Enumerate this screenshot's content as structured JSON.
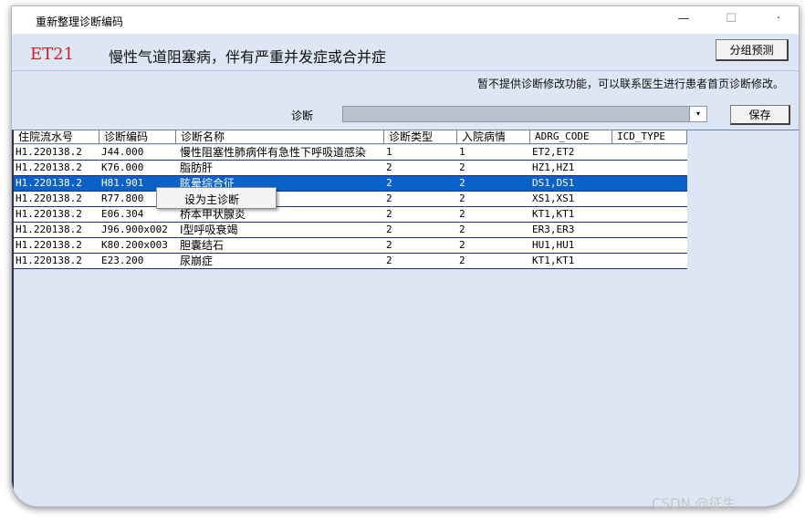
{
  "window": {
    "title": "重新整理诊断编码",
    "minimize": "—",
    "maximize": "☐",
    "close": "·"
  },
  "group": {
    "code": "ET21",
    "name": "慢性气道阻塞病，伴有严重并发症或合并症",
    "predict_label": "分组预测"
  },
  "notice": "暂不提供诊断修改功能，可以联系医生进行患者首页诊断修改。",
  "diagnosis": {
    "label": "诊断",
    "value": "",
    "arrow": "▾",
    "save_label": "保存"
  },
  "table": {
    "columns": [
      "住院流水号",
      "诊断编码",
      "诊断名称",
      "诊断类型",
      "入院病情",
      "ADRG_CODE",
      "ICD_TYPE"
    ],
    "rows": [
      [
        "H1.220138.2",
        "J44.000",
        "慢性阻塞性肺病伴有急性下呼吸道感染",
        "1",
        "1",
        "ET2,ET2",
        ""
      ],
      [
        "H1.220138.2",
        "K76.000",
        "脂肪肝",
        "2",
        "2",
        "HZ1,HZ1",
        ""
      ],
      [
        "H1.220138.2",
        "H81.901",
        "眩晕综合征",
        "2",
        "2",
        "DS1,DS1",
        ""
      ],
      [
        "H1.220138.2",
        "R77.800",
        "",
        "2",
        "2",
        "XS1,XS1",
        ""
      ],
      [
        "H1.220138.2",
        "E06.304",
        "桥本甲状腺炎",
        "2",
        "2",
        "KT1,KT1",
        ""
      ],
      [
        "H1.220138.2",
        "J96.900x002",
        "I型呼吸衰竭",
        "2",
        "2",
        "ER3,ER3",
        ""
      ],
      [
        "H1.220138.2",
        "K80.200x003",
        "胆囊结石",
        "2",
        "2",
        "HU1,HU1",
        ""
      ],
      [
        "H1.220138.2",
        "E23.200",
        "尿崩症",
        "2",
        "2",
        "KT1,KT1",
        ""
      ]
    ],
    "selected_row": 2
  },
  "context_menu": {
    "item": "设为主诊断"
  },
  "watermark": "CSDN @征生"
}
